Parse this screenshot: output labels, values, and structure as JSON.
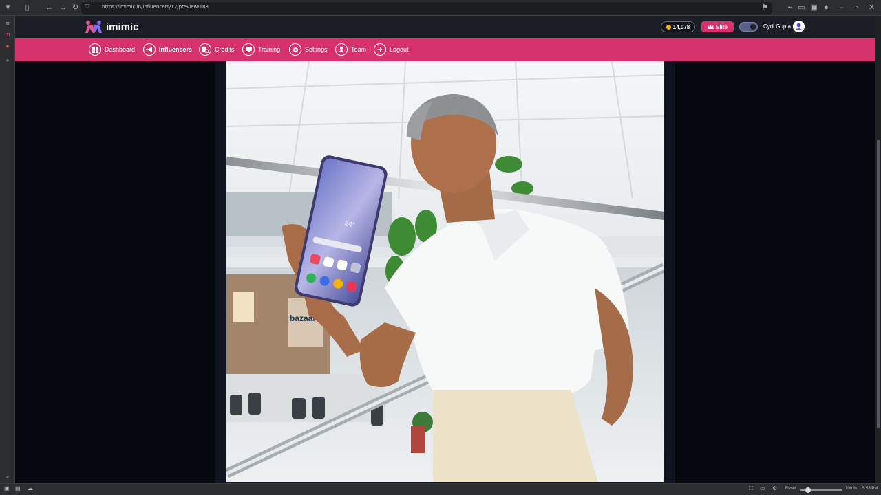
{
  "browser": {
    "url": "https://imimic.in/influencers/12/preview/183",
    "zoom": "100 %",
    "reset_label": "Reset",
    "time": "5:53 PM"
  },
  "site": {
    "brand": "imimic",
    "credits": "14,078",
    "elite_label": "Elite",
    "user_name": "Cyril Gupta",
    "colors": {
      "accent": "#d6336c",
      "header": "#1c1e26",
      "coin": "#f2b21a"
    }
  },
  "nav": {
    "items": [
      {
        "label": "Dashboard",
        "icon": "dashboard-icon"
      },
      {
        "label": "Influencers",
        "icon": "megaphone-icon"
      },
      {
        "label": "Credits",
        "icon": "credits-icon"
      },
      {
        "label": "Training",
        "icon": "training-icon"
      },
      {
        "label": "Settings",
        "icon": "gear-icon"
      },
      {
        "label": "Team",
        "icon": "team-icon"
      },
      {
        "label": "Logout",
        "icon": "logout-icon"
      }
    ],
    "active": "Influencers"
  }
}
